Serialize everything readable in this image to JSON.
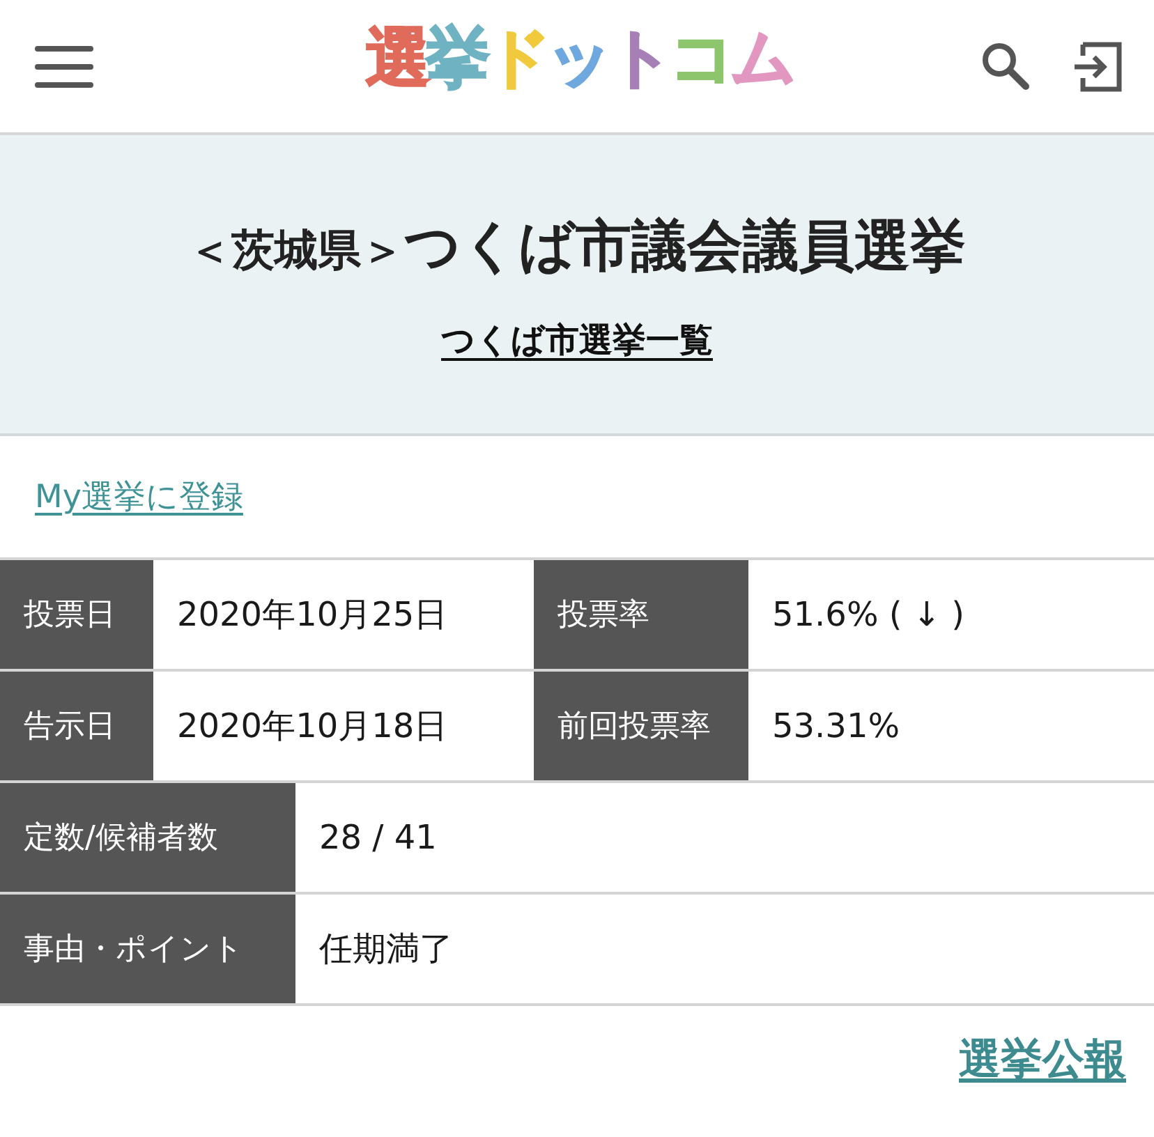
{
  "logo": [
    {
      "text": "選",
      "color": "#e06b5b"
    },
    {
      "text": "挙",
      "color": "#6fb2c1"
    },
    {
      "text": "ド",
      "color": "#f0c93c"
    },
    {
      "text": "ッ",
      "color": "#6ea8de"
    },
    {
      "text": "ト",
      "color": "#a67fb6"
    },
    {
      "text": "コ",
      "color": "#8dc56c"
    },
    {
      "text": "ム",
      "color": "#e197bf"
    }
  ],
  "title": {
    "prefecture": "＜茨城県＞",
    "name": "つくば市議会議員選挙",
    "city_link": "つくば市選挙一覧"
  },
  "register_link": "My選挙に登録",
  "info_table": {
    "rows": [
      {
        "cells": [
          {
            "label": "投票日",
            "value": "2020年10月25日"
          },
          {
            "label": "投票率",
            "value": "51.6% ( ↓ )"
          }
        ]
      },
      {
        "cells": [
          {
            "label": "告示日",
            "value": "2020年10月18日"
          },
          {
            "label": "前回投票率",
            "value": "53.31%"
          }
        ]
      },
      {
        "cells": [
          {
            "label": "定数/候補者数",
            "value": "28 / 41"
          }
        ]
      },
      {
        "cells": [
          {
            "label": "事由・ポイント",
            "value": "任期満了"
          }
        ]
      }
    ]
  },
  "bulletin_link": "選挙公報"
}
